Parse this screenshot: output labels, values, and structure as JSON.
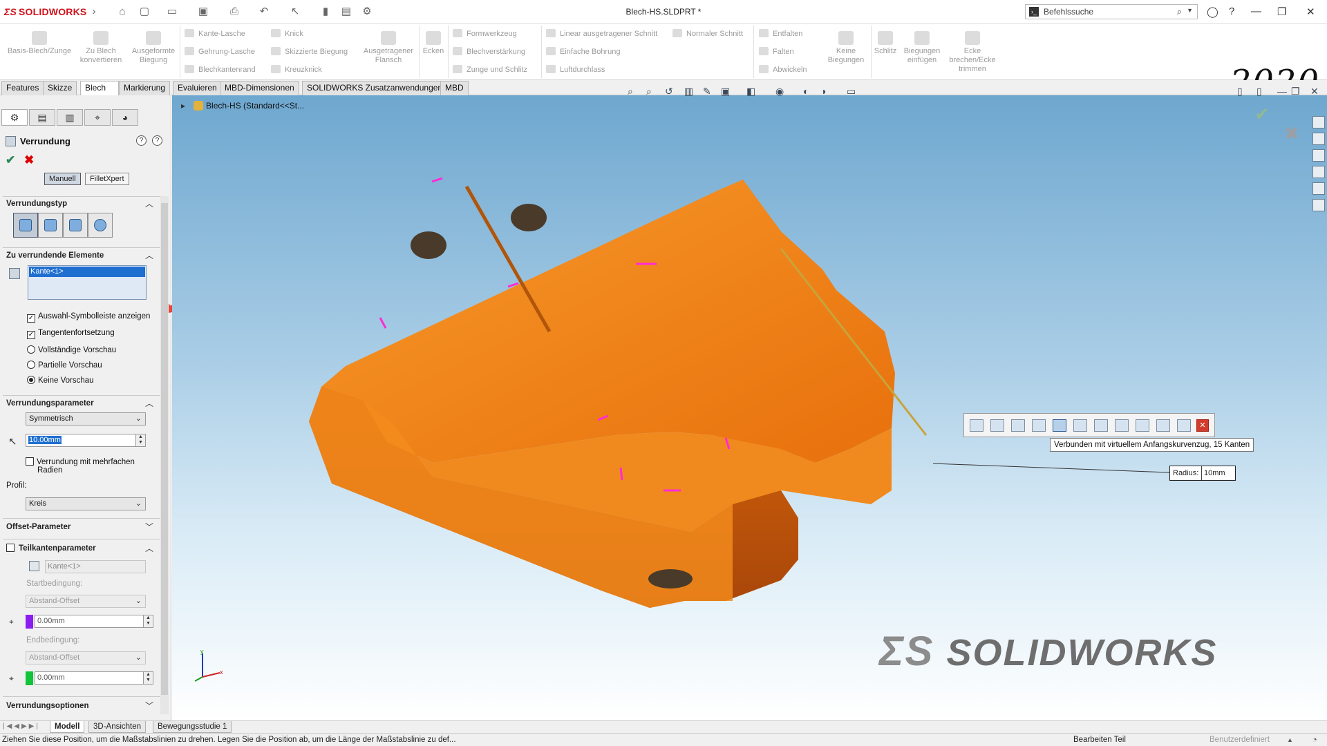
{
  "app": {
    "brand": "SOLIDWORKS",
    "title": "Blech-HS.SLDPRT *",
    "year_badge": "2020"
  },
  "search": {
    "placeholder": "Befehlssuche"
  },
  "ribbon": {
    "big": [
      {
        "label": "Basis-Blech/Zunge"
      },
      {
        "label": "Zu Blech konvertieren"
      },
      {
        "label": "Ausgeformte Biegung"
      },
      {
        "label": "Ausgetragener Flansch"
      },
      {
        "label": "Ecken"
      },
      {
        "label": "Keine Biegungen"
      },
      {
        "label": "Schlitz"
      },
      {
        "label": "Biegungen einfügen"
      },
      {
        "label": "Ecke brechen/Ecke trimmen"
      }
    ],
    "small": [
      "Kante-Lasche",
      "Gehrung-Lasche",
      "Blechkantenrand",
      "Knick",
      "Skizzierte Biegung",
      "Kreuzknick",
      "Formwerkzeug",
      "Blechverstärkung",
      "Zunge und Schlitz",
      "Linear ausgetragener Schnitt",
      "Einfache Bohrung",
      "Luftdurchlass",
      "Normaler Schnitt",
      "Entfalten",
      "Falten",
      "Abwickeln"
    ]
  },
  "tabs": [
    "Features",
    "Skizze",
    "Blech",
    "Markierung",
    "Evaluieren",
    "MBD-Dimensionen",
    "SOLIDWORKS Zusatzanwendungen",
    "MBD"
  ],
  "active_tab": "Blech",
  "panel": {
    "title": "Verrundung",
    "mode_manual": "Manuell",
    "mode_filletxpert": "FilletXpert",
    "section_type": "Verrundungstyp",
    "section_items": "Zu verrundende Elemente",
    "selected_item": "Kante<1>",
    "opt_toolbar": "Auswahl-Symbolleiste anzeigen",
    "opt_tangent": "Tangentenfortsetzung",
    "opt_full_preview": "Vollständige Vorschau",
    "opt_partial_preview": "Partielle Vorschau",
    "opt_no_preview": "Keine Vorschau",
    "section_params": "Verrundungsparameter",
    "param_mode": "Symmetrisch",
    "radius_value": "10.00mm",
    "multi_radius_line1": "Verrundung mit mehrfachen",
    "multi_radius_line2": "Radien",
    "profile_label": "Profil:",
    "profile_value": "Kreis",
    "section_offset": "Offset-Parameter",
    "section_partial": "Teilkantenparameter",
    "partial_item": "Kante<1>",
    "start_condition_label": "Startbedingung:",
    "start_condition_value": "Abstand-Offset",
    "start_value": "0.00mm",
    "end_condition_label": "Endbedingung:",
    "end_condition_value": "Abstand-Offset",
    "end_value": "0.00mm",
    "section_options": "Verrundungsoptionen"
  },
  "viewport": {
    "tree_label": "Blech-HS  (Standard<<St...",
    "tooltip": "Verbunden mit virtuellem Anfangskurvenzug, 15 Kanten",
    "radius_label": "Radius:",
    "radius_value": "10mm",
    "watermark": "SOLIDWORKS"
  },
  "bottom_tabs": [
    "Modell",
    "3D-Ansichten",
    "Bewegungsstudie 1"
  ],
  "status": {
    "message": "Ziehen Sie diese Position, um die Maßstabslinien zu drehen. Legen Sie die Position ab, um die Länge der Maßstabslinie zu def...",
    "mode": "Bearbeiten Teil",
    "units": "Benutzerdefiniert"
  },
  "colors": {
    "part_orange": "#f28a1c",
    "edge_magenta": "#ff2bd6",
    "brand_red": "#d0111b",
    "annotation_red": "#e8453c"
  }
}
